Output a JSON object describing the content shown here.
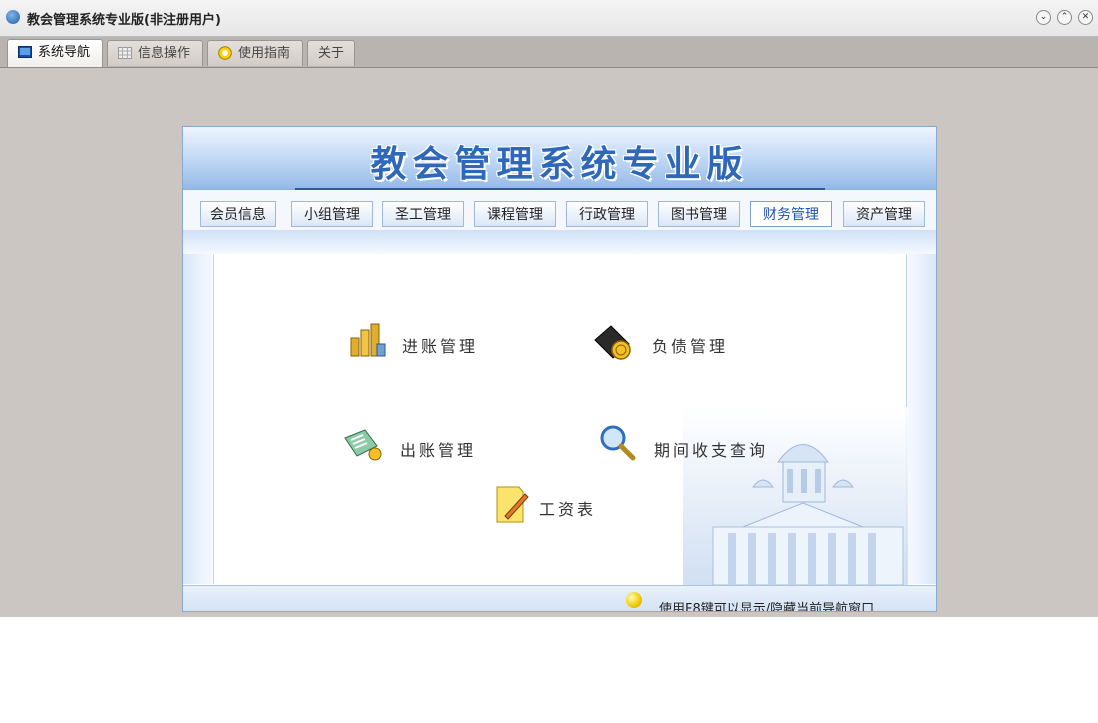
{
  "window": {
    "title": "教会管理系统专业版(非注册用户)",
    "controls": {
      "minimize": "⌄",
      "maximize": "⌃",
      "close": "✕"
    }
  },
  "app_tabs": [
    {
      "label": "系统导航",
      "icon": "monitor-icon",
      "active": true
    },
    {
      "label": "信息操作",
      "icon": "grid-icon",
      "active": false
    },
    {
      "label": "使用指南",
      "icon": "help-icon",
      "active": false
    },
    {
      "label": "关于",
      "icon": "",
      "active": false
    }
  ],
  "banner": {
    "title": "教会管理系统专业版"
  },
  "modules": [
    {
      "label": "会员信息",
      "active": false
    },
    {
      "label": "小组管理",
      "active": false
    },
    {
      "label": "圣工管理",
      "active": false
    },
    {
      "label": "课程管理",
      "active": false
    },
    {
      "label": "行政管理",
      "active": false
    },
    {
      "label": "图书管理",
      "active": false
    },
    {
      "label": "财务管理",
      "active": true
    },
    {
      "label": "资产管理",
      "active": false
    }
  ],
  "finance_menu": {
    "income": {
      "label": "进账管理",
      "icon": "coins-icon"
    },
    "liability": {
      "label": "负债管理",
      "icon": "wallet-icon"
    },
    "expense": {
      "label": "出账管理",
      "icon": "calculator-icon"
    },
    "period_query": {
      "label": "期间收支查询",
      "icon": "magnifier-icon"
    },
    "payroll": {
      "label": "工资表",
      "icon": "notepad-icon"
    }
  },
  "status": {
    "hint": "使用F8键可以显示/隐藏当前导航窗口",
    "icon": "lightbulb-icon"
  },
  "colors": {
    "accent": "#2f67b9",
    "active_module": "#2050b8",
    "window_bg": "#cbc6c1"
  }
}
